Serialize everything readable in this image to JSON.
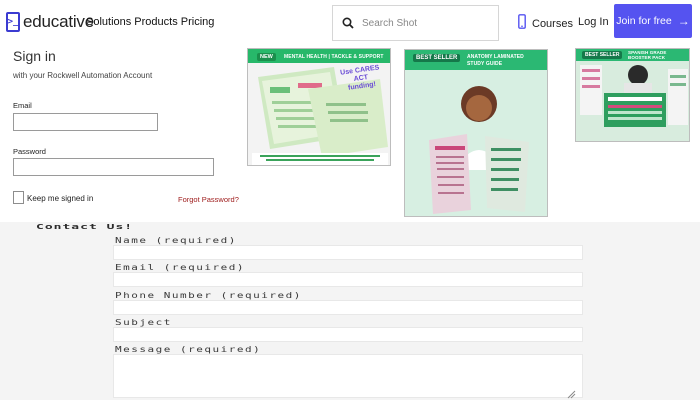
{
  "header": {
    "logo_glyph": ">_",
    "logo_text": "educative",
    "nav": "Solutions Products Pricing",
    "search_placeholder": "Search Shot",
    "courses_label": "Courses",
    "login_label": "Log In",
    "join_label": "Join for free",
    "join_arrow": "→",
    "accent": "#5553f0"
  },
  "signin": {
    "title": "Sign in",
    "subtitle": "with your Rockwell Automation Account",
    "email_label": "Email",
    "email_value": "",
    "password_label": "Password",
    "password_value": "",
    "keep_label": "Keep me signed in",
    "forgot_label": "Forgot Password?"
  },
  "promos": [
    {
      "badge": "NEW",
      "title": "MENTAL HEALTH | TACKLE & SUPPORT",
      "overlay": "Use CARES ACT funding!"
    },
    {
      "badge": "BEST SELLER",
      "title": "ANATOMY LAMINATED STUDY GUIDE"
    },
    {
      "badge": "BEST SELLER",
      "title": "SPANISH GRADE BOOSTER PACK"
    }
  ],
  "contact": {
    "title": "Contact Us!",
    "fields": [
      {
        "label": "Name (required)",
        "value": ""
      },
      {
        "label": "Email (required)",
        "value": ""
      },
      {
        "label": "Phone Number (required)",
        "value": ""
      },
      {
        "label": "Subject",
        "value": ""
      },
      {
        "label": "Message (required)",
        "value": ""
      }
    ]
  }
}
